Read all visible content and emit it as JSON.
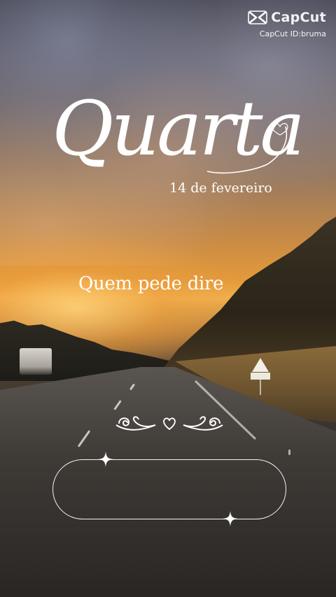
{
  "watermark": {
    "brand": "CapCut",
    "id_label": "CapCut ID:bruma",
    "icon": "capcut-logo-icon"
  },
  "card": {
    "title": "Quarta",
    "date": "14 de fevereiro",
    "quote": "Quem pede dire",
    "ornament_icon": "flourish-heart-icon",
    "sparkle_icon": "sparkle-icon",
    "frame_text": ""
  },
  "colors": {
    "text": "#ffffff",
    "sky_top": "#3c3b47",
    "sunset": "#f0b050",
    "road": "#2a2623"
  }
}
